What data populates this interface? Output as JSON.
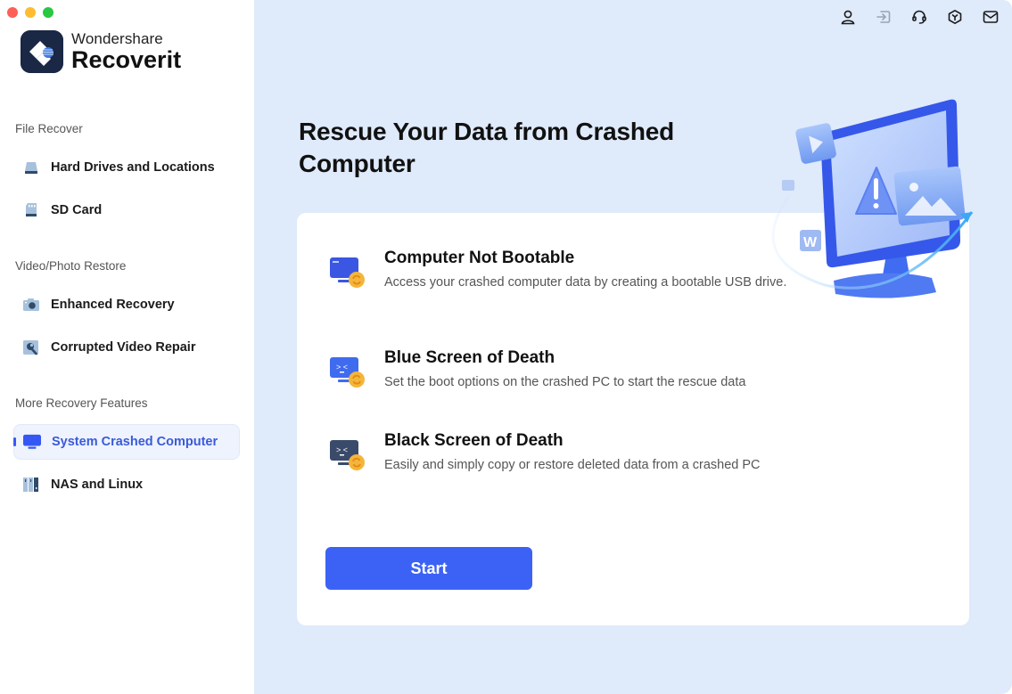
{
  "window": {
    "traffic_lights": [
      "close",
      "minimize",
      "maximize"
    ]
  },
  "brand": {
    "company": "Wondershare",
    "product": "Recoverit",
    "logo_icon": "recoverit-logo-icon"
  },
  "sidebar": {
    "sections": [
      {
        "label": "File Recover",
        "items": [
          {
            "label": "Hard Drives and Locations",
            "icon": "hard-drive-icon",
            "active": false
          },
          {
            "label": "SD Card",
            "icon": "sd-card-icon",
            "active": false
          }
        ]
      },
      {
        "label": "Video/Photo Restore",
        "items": [
          {
            "label": "Enhanced Recovery",
            "icon": "camera-icon",
            "active": false
          },
          {
            "label": "Corrupted Video Repair",
            "icon": "wrench-icon",
            "active": false
          }
        ]
      },
      {
        "label": "More Recovery Features",
        "items": [
          {
            "label": "System Crashed Computer",
            "icon": "monitor-icon",
            "active": true
          },
          {
            "label": "NAS and Linux",
            "icon": "nas-icon",
            "active": false
          }
        ]
      }
    ]
  },
  "toolbar": {
    "icons": [
      "user-icon",
      "sign-in-icon",
      "headset-icon",
      "box-icon",
      "mail-icon"
    ]
  },
  "main": {
    "title": "Rescue Your Data from Crashed Computer",
    "options": [
      {
        "title": "Computer Not Bootable",
        "description": "Access your crashed computer data by creating a bootable USB drive.",
        "icon": "monitor-sync-icon"
      },
      {
        "title": "Blue Screen of Death",
        "description": "Set the boot options on the crashed PC to start the rescue data",
        "icon": "blue-screen-icon"
      },
      {
        "title": "Black Screen of Death",
        "description": "Easily and simply copy or restore deleted data from a crashed PC",
        "icon": "black-screen-icon"
      }
    ],
    "start_label": "Start",
    "hero_illustration": "crashed-computer-illustration"
  },
  "colors": {
    "accent": "#3c62f5",
    "main_bg": "#dfeafb",
    "active_nav_text": "#3a5ad9",
    "sidebar_icon": "#a7c1dc",
    "sidebar_icon_dark": "#2f4a6b"
  }
}
